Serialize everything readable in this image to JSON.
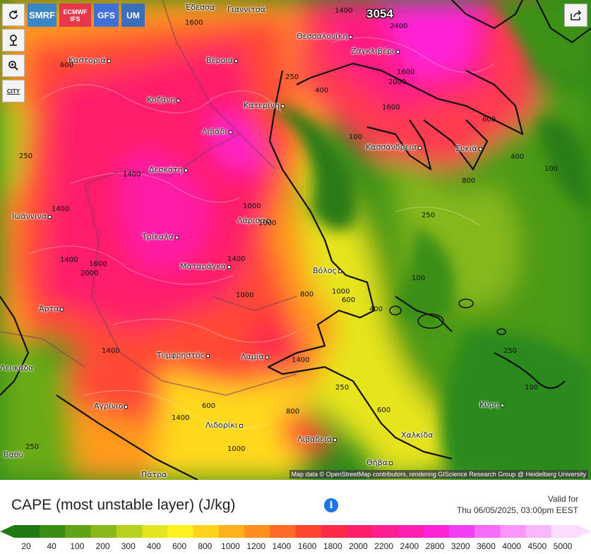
{
  "toolbar": {
    "refresh_icon": "refresh-icon",
    "location_icon": "location-pin-icon",
    "zoom_icon": "zoom-icon",
    "city_toggle_label": "CITY",
    "share_icon": "share-icon"
  },
  "models": [
    {
      "label": "SMRF",
      "color": "#3a86c8"
    },
    {
      "label": "ECMWF IFS",
      "color": "#e8364a"
    },
    {
      "label": "GFS",
      "color": "#3f6fd8"
    },
    {
      "label": "UM",
      "color": "#3b6fb9"
    }
  ],
  "max_value": "3054",
  "cities": [
    {
      "name": "Έδεσσα"
    },
    {
      "name": "Γιαννιτσά"
    },
    {
      "name": "Θεσσαλονίκη"
    },
    {
      "name": "Ζαγκλιβέρι"
    },
    {
      "name": "Καστοριά"
    },
    {
      "name": "Βέροια"
    },
    {
      "name": "Κοζάνη"
    },
    {
      "name": "Κατερίνη"
    },
    {
      "name": "Λιβάδι"
    },
    {
      "name": "Κασσάνδρεια"
    },
    {
      "name": "Συκιά"
    },
    {
      "name": "Δεσκάτη"
    },
    {
      "name": "Ιωάννινα"
    },
    {
      "name": "Λάρισα"
    },
    {
      "name": "Τρίκαλα"
    },
    {
      "name": "Ματαράγκα"
    },
    {
      "name": "Βόλος"
    },
    {
      "name": "Άρτα"
    },
    {
      "name": "Τυμφρηστός"
    },
    {
      "name": "Λαμία"
    },
    {
      "name": "Λευκάδα"
    },
    {
      "name": "Αγρίνιο"
    },
    {
      "name": "Λιδορίκι"
    },
    {
      "name": "Λιβαδειά"
    },
    {
      "name": "Χαλκίδα"
    },
    {
      "name": "Κύμη"
    },
    {
      "name": "Θήβα"
    },
    {
      "name": "Βαθύ"
    },
    {
      "name": "Πάτρα"
    }
  ],
  "contour_labels": [
    "1400",
    "1600",
    "2400",
    "600",
    "250",
    "400",
    "1600",
    "2000",
    "1600",
    "600",
    "100",
    "400",
    "100",
    "250",
    "1400",
    "1000",
    "1000",
    "1400",
    "2000",
    "1400",
    "1600",
    "1000",
    "1000",
    "600",
    "400",
    "100",
    "800",
    "1400",
    "1400",
    "250",
    "1400",
    "250",
    "600",
    "800",
    "600",
    "250",
    "1400",
    "1000",
    "100",
    "250",
    "800"
  ],
  "attribution": "Map data © OpenStreetMap contributors, rendering GIScience Research Group @ Heidelberg University",
  "legend": {
    "title": "CAPE (most unstable layer) (J/kg)",
    "valid_label": "Valid for",
    "valid_date": "Thu 06/05/2025, 03:00pm EEST",
    "info_icon": "info-icon",
    "values": [
      "20",
      "40",
      "100",
      "200",
      "300",
      "400",
      "600",
      "800",
      "1000",
      "1200",
      "1400",
      "1600",
      "1800",
      "2000",
      "2200",
      "2400",
      "2800",
      "3200",
      "3600",
      "4000",
      "4500",
      "5000"
    ],
    "colors": [
      "#1f7a12",
      "#3a8e14",
      "#5fa416",
      "#8ab81a",
      "#b7cf1e",
      "#e1e61e",
      "#fff21e",
      "#ffd21c",
      "#ffb01c",
      "#ff8e1e",
      "#ff6a24",
      "#ff4430",
      "#ff2a48",
      "#ff1e6a",
      "#ff1e90",
      "#ff1eb4",
      "#ff22d8",
      "#f23ef2",
      "#f66cf8",
      "#f894fa",
      "#fab8fc",
      "#fcdcfe"
    ]
  }
}
